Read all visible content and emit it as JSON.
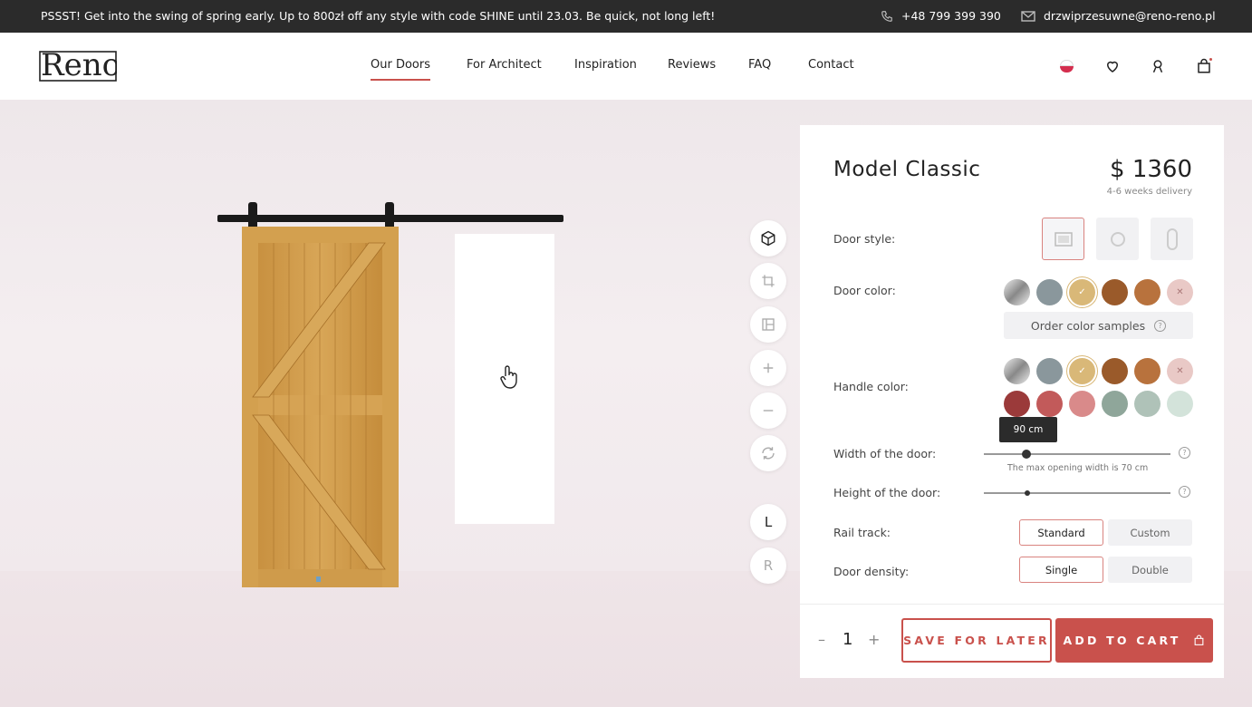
{
  "promo": {
    "text": "PSSST! Get into the swing of spring early. Up to 800zł off any style with code SHINE until 23.03. Be quick, not long left!",
    "phone": "+48 799 399 390",
    "email": "drzwiprzesuwne@reno-reno.pl",
    "phone_icon": "phone-icon",
    "mail_icon": "mail-icon"
  },
  "header": {
    "logo_text": "Reno",
    "nav": [
      "Our Doors",
      "For Architect",
      "Inspiration",
      "Reviews",
      "FAQ",
      "Contact"
    ],
    "active_nav": "Our Doors",
    "icons": [
      "flag-icon",
      "heart-icon",
      "user-icon",
      "bag-icon"
    ]
  },
  "toolbar": {
    "icons": [
      "cube-icon",
      "crop-icon",
      "layout-icon",
      "zoom-in-icon",
      "zoom-out-icon",
      "rotate-icon"
    ],
    "left_label": "L",
    "right_label": "R"
  },
  "product": {
    "title": "Model Classic",
    "price": "$ 1360",
    "delivery": "4-6 weeks delivery",
    "door_style_label": "Door style:",
    "door_color_label": "Door color:",
    "order_samples_label": "Order color samples",
    "handle_color_label": "Handle color:",
    "width_label": "Width of the door:",
    "width_tooltip": "90 cm",
    "width_note": "The max opening width is 70 cm",
    "height_label": "Height of the door:",
    "rail_label": "Rail track:",
    "rail_options": [
      "Standard",
      "Custom"
    ],
    "rail_selected": "Standard",
    "density_label": "Door density:",
    "density_options": [
      "Single",
      "Double"
    ],
    "density_selected": "Single",
    "door_colors": [
      "#c9c9c9",
      "#8a979c",
      "#d9b878",
      "#9a5a2a",
      "#b8723d",
      "#e9c9c6"
    ],
    "handle_colors": [
      "#c9c9c9",
      "#8a979c",
      "#d9b878",
      "#9a5a2a",
      "#b8723d",
      "#e9c9c6",
      "#9b3a3a",
      "#c25a5a",
      "#d98a8a",
      "#8fa69a",
      "#afc2b8",
      "#d3e3da"
    ]
  },
  "cart": {
    "quantity": "1",
    "minus": "–",
    "plus": "+",
    "save_label": "SAVE FOR LATER",
    "add_label": "ADD TO CART"
  }
}
